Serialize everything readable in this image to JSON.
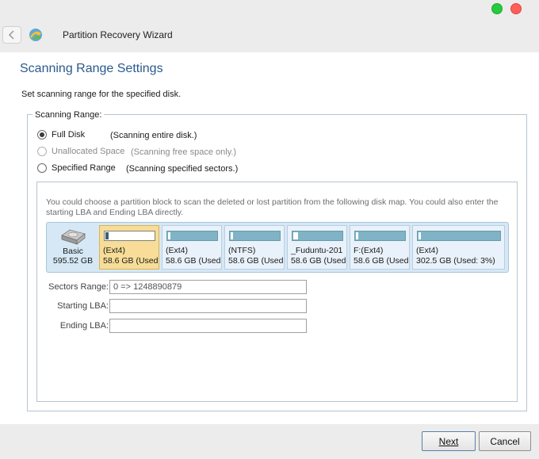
{
  "window": {
    "title": "Partition Recovery Wizard"
  },
  "page": {
    "title": "Scanning Range Settings",
    "subtitle": "Set scanning range for the specified disk."
  },
  "scanning_range": {
    "legend": "Scanning Range:",
    "options": [
      {
        "label": "Full Disk",
        "description": "(Scanning entire disk.)",
        "selected": true,
        "disabled": false
      },
      {
        "label": "Unallocated Space",
        "description": "(Scanning free space only.)",
        "selected": false,
        "disabled": true
      },
      {
        "label": "Specified Range",
        "description": "(Scanning specified sectors.)",
        "selected": false,
        "disabled": false
      }
    ]
  },
  "disk_map": {
    "info": "You could choose a partition block to scan the deleted or lost partition from the following disk map. You could also enter the starting LBA and Ending LBA directly.",
    "disk": {
      "type": "Basic",
      "size": "595.52 GB"
    },
    "partitions": [
      {
        "name": "(Ext4)",
        "detail": "58.6 GB (Used",
        "used_fraction": 0.02,
        "selected": true
      },
      {
        "name": "(Ext4)",
        "detail": "58.6 GB (Used",
        "used_fraction": 0.03,
        "selected": false
      },
      {
        "name": "(NTFS)",
        "detail": "58.6 GB (Used",
        "used_fraction": 0.01,
        "selected": false
      },
      {
        "name": "_Fuduntu-201",
        "detail": "58.6 GB (Used",
        "used_fraction": 0.1,
        "selected": false
      },
      {
        "name": "F:(Ext4)",
        "detail": "58.6 GB (Used",
        "used_fraction": 0.03,
        "selected": false
      },
      {
        "name": "(Ext4)",
        "detail": "302.5 GB (Used: 3%)",
        "used_fraction": 0.03,
        "selected": false
      }
    ]
  },
  "fields": {
    "sectors_range_label": "Sectors Range:",
    "sectors_range_value": "0 => 1248890879",
    "starting_lba_label": "Starting LBA:",
    "starting_lba_value": "",
    "ending_lba_label": "Ending LBA:",
    "ending_lba_value": ""
  },
  "buttons": {
    "next": "Next",
    "cancel": "Cancel"
  },
  "colors": {
    "title_blue": "#2b5a8c",
    "selected_partition": "#f7dd97",
    "partition_bg": "#e9f2fa",
    "disk_map_bg": "#d6e8f5"
  }
}
